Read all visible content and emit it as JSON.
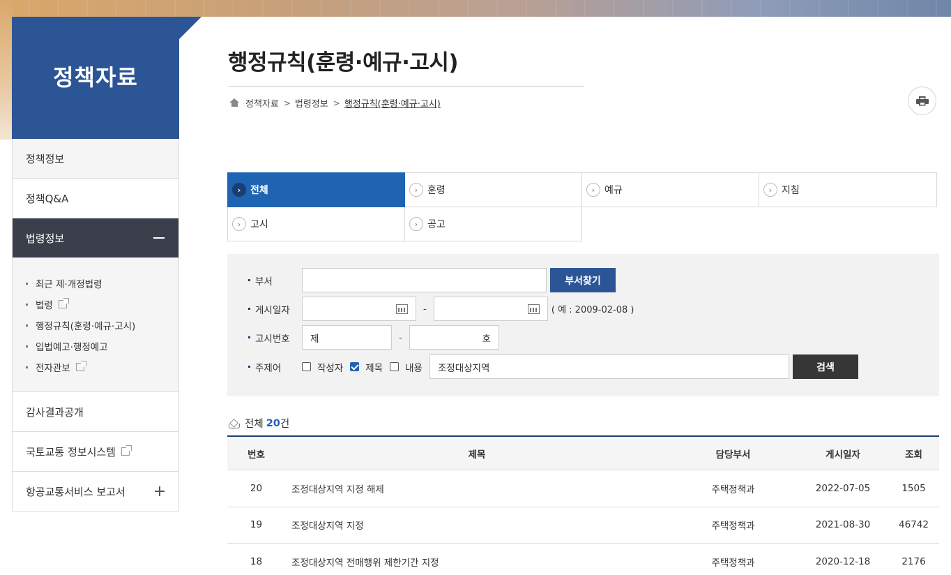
{
  "sidebar": {
    "title": "정책자료",
    "menu": [
      {
        "label": "정책정보"
      },
      {
        "label": "정책Q&A"
      },
      {
        "label": "법령정보"
      }
    ],
    "submenu": [
      {
        "label": "최근 제·개정법령"
      },
      {
        "label": "법령"
      },
      {
        "label": "행정규칙(훈령·예규·고시)"
      },
      {
        "label": "입법예고·행정예고"
      },
      {
        "label": "전자관보"
      }
    ],
    "menu_after": [
      {
        "label": "감사결과공개"
      },
      {
        "label": "국토교통 정보시스템"
      },
      {
        "label": "항공교통서비스 보고서"
      }
    ]
  },
  "page": {
    "title": "행정규칙(훈령·예규·고시)",
    "breadcrumb": [
      "정책자료",
      "법령정보",
      "행정규칙(훈령·예규·고시)"
    ]
  },
  "tabs": [
    {
      "label": "전체",
      "active": true
    },
    {
      "label": "훈령"
    },
    {
      "label": "예규"
    },
    {
      "label": "지침"
    },
    {
      "label": "고시"
    },
    {
      "label": "공고"
    }
  ],
  "search": {
    "dept_label": "부서",
    "dept_value": "",
    "dept_button": "부서찾기",
    "date_label": "게시일자",
    "date_from": "",
    "date_to": "",
    "date_hint": "( 예 : 2009-02-08 )",
    "notice_label": "고시번호",
    "notice_prefix": "제",
    "notice_suffix": "호",
    "keyword_label": "주제어",
    "checkboxes": [
      {
        "label": "작성자",
        "checked": false
      },
      {
        "label": "제목",
        "checked": true
      },
      {
        "label": "내용",
        "checked": false
      }
    ],
    "keyword_value": "조정대상지역",
    "search_button": "검색"
  },
  "results": {
    "count_prefix": "전체",
    "count_num": "20",
    "count_suffix": "건"
  },
  "table": {
    "headers": [
      "번호",
      "제목",
      "담당부서",
      "게시일자",
      "조회"
    ],
    "rows": [
      {
        "no": "20",
        "title": "조정대상지역 지정 해제",
        "dept": "주택정책과",
        "date": "2022-07-05",
        "views": "1505"
      },
      {
        "no": "19",
        "title": "조정대상지역 지정",
        "dept": "주택정책과",
        "date": "2021-08-30",
        "views": "46742"
      },
      {
        "no": "18",
        "title": "조정대상지역 전매행위 제한기간 지정",
        "dept": "주택정책과",
        "date": "2020-12-18",
        "views": "2176"
      }
    ]
  }
}
